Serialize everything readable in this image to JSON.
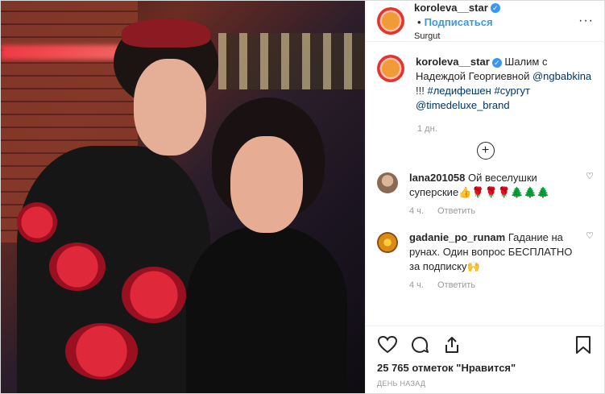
{
  "header": {
    "username": "koroleva__star",
    "verified_mark": "✓",
    "separator": "•",
    "follow_label": "Подписаться",
    "location": "Surgut",
    "more_label": "···"
  },
  "caption": {
    "username": "koroleva__star",
    "text_1": "Шалим с Надеждой Георгиевной",
    "mention_1": "@ngbabkina",
    "text_2": "!!!",
    "hashtag_1": "#ледифешен",
    "hashtag_2": "#сургут",
    "mention_2": "@timedeluxe_brand",
    "time": "1 дн."
  },
  "load_more_label": "+",
  "comments": [
    {
      "username": "lana201058",
      "text": "Ой веселушки суперские👍🌹🌹🌹🌲🌲🌲",
      "time": "4 ч.",
      "reply_label": "Ответить"
    },
    {
      "username": "gadanie_po_runam",
      "text": "Гадание на рунах. Один вопрос БЕСПЛАТНО за подписку🙌",
      "time": "4 ч.",
      "reply_label": "Ответить"
    }
  ],
  "actions": {
    "likes_text": "25 765 отметок \"Нравится\"",
    "date_text": "ДЕНЬ НАЗАД"
  },
  "colors": {
    "accent": "#3897f0",
    "text": "#262626",
    "muted": "#999999",
    "border": "#dbdbdb"
  },
  "icons": [
    "heart-icon",
    "comment-icon",
    "share-icon",
    "bookmark-icon",
    "verified-icon",
    "add-comments-icon"
  ]
}
